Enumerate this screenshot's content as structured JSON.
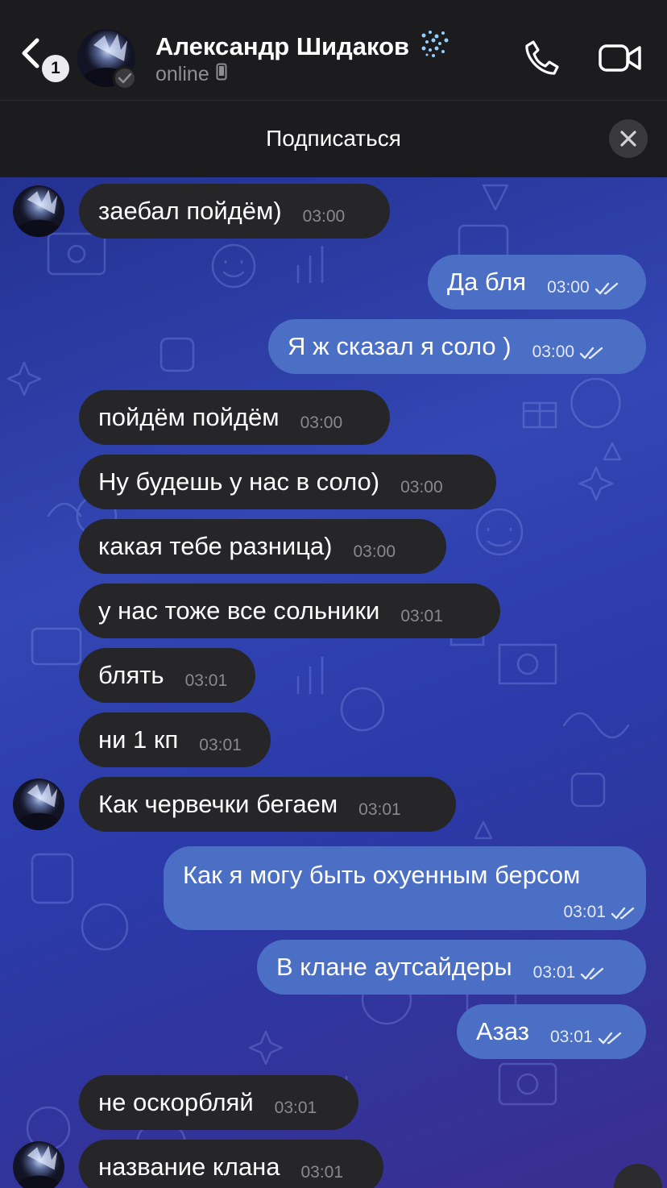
{
  "header": {
    "back_badge": "1",
    "contact_name": "Александр Шидаков",
    "status": "online"
  },
  "subscribe": {
    "label": "Подписаться"
  },
  "messages": [
    {
      "dir": "in",
      "text": "заебал пойдём)",
      "time": "03:00"
    },
    {
      "dir": "out",
      "text": "Да бля",
      "time": "03:00"
    },
    {
      "dir": "out",
      "text": "Я ж сказал я соло )",
      "time": "03:00"
    },
    {
      "dir": "in",
      "text": "пойдём пойдём",
      "time": "03:00"
    },
    {
      "dir": "in",
      "text": "Ну будешь у нас в соло)",
      "time": "03:00"
    },
    {
      "dir": "in",
      "text": "какая тебе разница)",
      "time": "03:00"
    },
    {
      "dir": "in",
      "text": "у нас тоже все сольники",
      "time": "03:01"
    },
    {
      "dir": "in",
      "text": "блять",
      "time": "03:01"
    },
    {
      "dir": "in",
      "text": "ни 1 кп",
      "time": "03:01"
    },
    {
      "dir": "in",
      "text": "Как червечки бегаем",
      "time": "03:01"
    },
    {
      "dir": "out",
      "text": "Как я могу быть охуенным берсом",
      "time": "03:01"
    },
    {
      "dir": "out",
      "text": "В клане аутсайдеры",
      "time": "03:01"
    },
    {
      "dir": "out",
      "text": "Азаз",
      "time": "03:01"
    },
    {
      "dir": "in",
      "text": "не оскорбляй",
      "time": "03:01"
    },
    {
      "dir": "in",
      "text": "название клана",
      "time": "03:01"
    }
  ],
  "colors": {
    "incoming_bubble": "#262628",
    "outgoing_bubble": "#4b6fc4",
    "chat_bg": "#2f40ad",
    "header_bg": "#1c1c1e"
  },
  "icons": [
    "back-chevron-icon",
    "phone-icon",
    "video-camera-icon",
    "close-icon",
    "double-check-icon",
    "sparkles-emoji-icon",
    "mobile-device-icon",
    "verified-check-icon"
  ]
}
